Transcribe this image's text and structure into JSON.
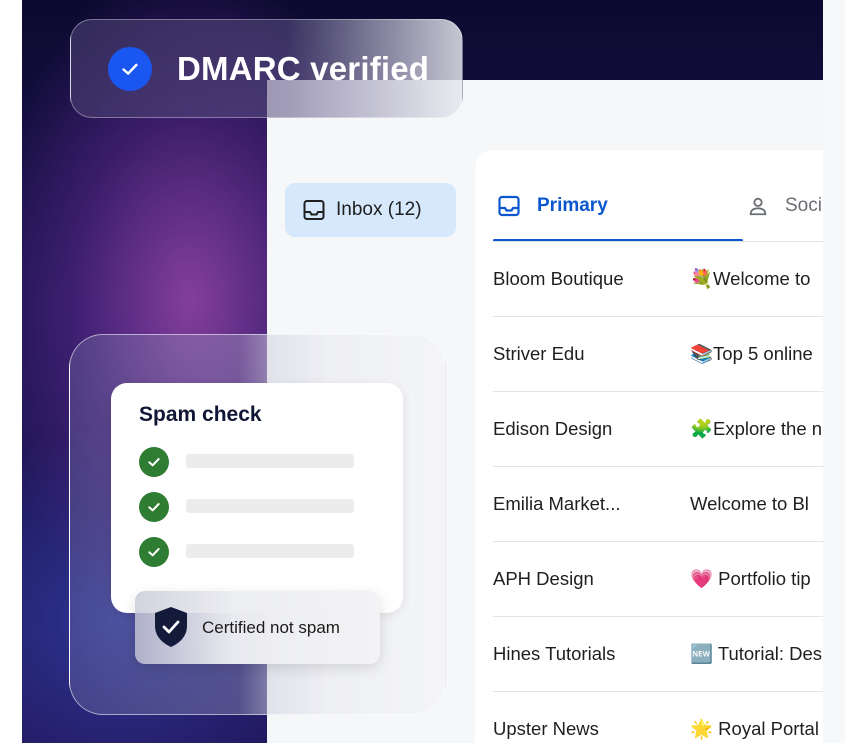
{
  "dmarc_badge": {
    "label": "DMARC verified",
    "icon": "check-icon",
    "color": "#1a56f0"
  },
  "sidebar": {
    "inbox_label": "Inbox (12)",
    "icon": "inbox-tray-icon"
  },
  "tabs": [
    {
      "label": "Primary",
      "icon": "inbox-tray-icon",
      "active": true,
      "color": "#0b57d0"
    },
    {
      "label": "Soci",
      "icon": "person-icon",
      "active": false
    }
  ],
  "emails": [
    {
      "sender": "Bloom Boutique",
      "subject": "💐Welcome to"
    },
    {
      "sender": "Striver Edu",
      "subject": "📚Top 5 online"
    },
    {
      "sender": "Edison Design",
      "subject": "🧩Explore the n"
    },
    {
      "sender": "Emilia Market...",
      "subject": "Welcome to Bl"
    },
    {
      "sender": "APH Design",
      "subject": "💗 Portfolio tip"
    },
    {
      "sender": "Hines Tutorials",
      "subject": "🆕 Tutorial: Des"
    },
    {
      "sender": "Upster News",
      "subject": "🌟 Royal Portal"
    }
  ],
  "spam_check": {
    "title": "Spam check",
    "checks": 3,
    "check_color": "#2e7d32",
    "certified_label": "Certified not spam",
    "certified_icon": "shield-check-icon"
  }
}
